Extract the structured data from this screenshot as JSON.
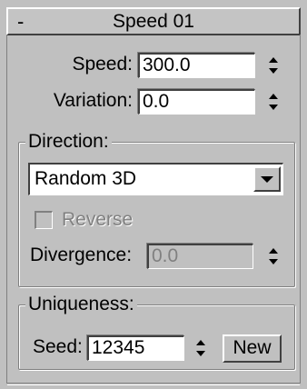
{
  "rollout": {
    "collapse_symbol": "-",
    "title": "Speed 01"
  },
  "speed": {
    "label": "Speed:",
    "value": "300.0"
  },
  "variation": {
    "label": "Variation:",
    "value": "0.0"
  },
  "direction": {
    "group_title": "Direction:",
    "dropdown_value": "Random 3D",
    "reverse_label": "Reverse",
    "reverse_checked": false,
    "reverse_enabled": false,
    "divergence_label": "Divergence:",
    "divergence_value": "0.0",
    "divergence_enabled": false
  },
  "uniqueness": {
    "group_title": "Uniqueness:",
    "seed_label": "Seed:",
    "seed_value": "12345",
    "new_button_label": "New"
  },
  "colors": {
    "panel_background": "#c0c0c0",
    "field_background": "#ffffff",
    "disabled_text": "#808080"
  },
  "icons": {
    "spinner": "up-down-spinner-icon",
    "dropdown": "chevron-down-icon"
  }
}
